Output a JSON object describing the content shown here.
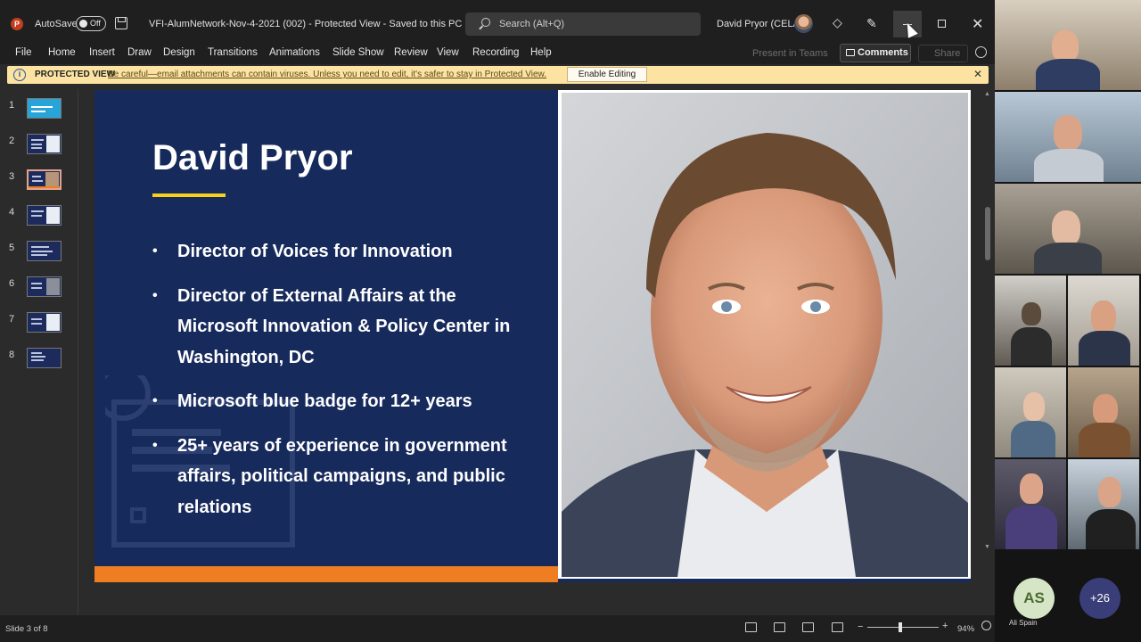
{
  "titlebar": {
    "app_logo": "P",
    "autosave_label": "AutoSave",
    "autosave_state": "Off",
    "document_title": "VFI-AlumNetwork-Nov-4-2021 (002)  -  Protected View  -  Saved to this PC",
    "search_placeholder": "Search (Alt+Q)",
    "user_name": "David Pryor (CELA)"
  },
  "menu": {
    "tabs": [
      "File",
      "Home",
      "Insert",
      "Draw",
      "Design",
      "Transitions",
      "Animations",
      "Slide Show",
      "Review",
      "View",
      "Recording",
      "Help"
    ],
    "present_in_teams": "Present in Teams",
    "comments": "Comments",
    "share": "Share"
  },
  "protected_view": {
    "label": "PROTECTED VIEW",
    "message": "Be careful—email attachments can contain viruses. Unless you need to edit, it's safer to stay in Protected View.",
    "enable_button": "Enable Editing"
  },
  "thumbnails": [
    "1",
    "2",
    "3",
    "4",
    "5",
    "6",
    "7",
    "8"
  ],
  "active_slide": 3,
  "slide": {
    "title": "David Pryor",
    "bullets": [
      "Director of Voices for Innovation",
      "Director of External Affairs at the Microsoft Innovation & Policy Center in Washington, DC",
      "Microsoft blue badge for 12+ years",
      "25+ years of experience in government affairs, political campaigns, and public relations"
    ]
  },
  "statusbar": {
    "slide_counter": "Slide 3 of 8",
    "zoom": "94%"
  },
  "teams": {
    "participant_initials": "AS",
    "participant_name": "Ali Spain",
    "overflow_count": "+26"
  },
  "colors": {
    "slide_background": "#172a5c",
    "title_underline": "#f2d21a",
    "footer_bar": "#ef7d22",
    "protected_bar": "#fce3a1",
    "teams_overflow": "#3a3e78"
  }
}
